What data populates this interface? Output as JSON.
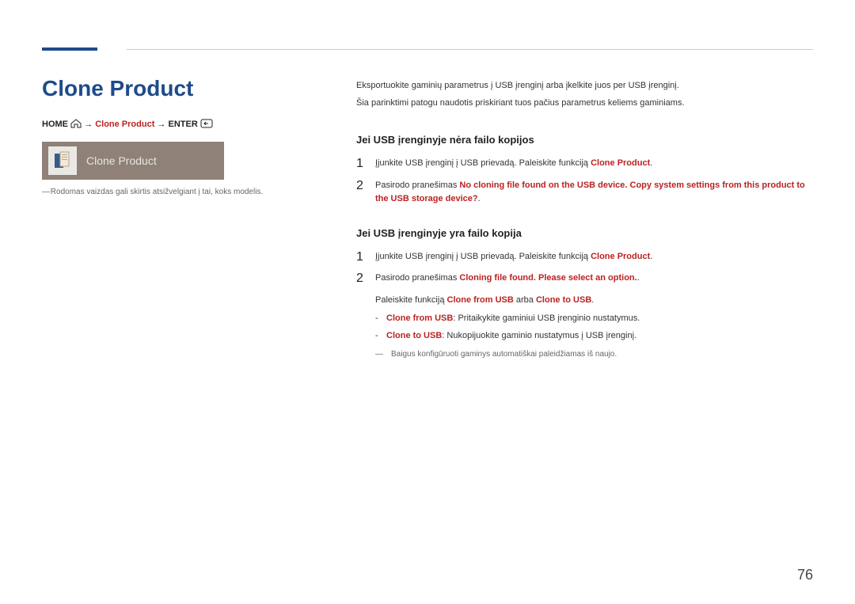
{
  "title": "Clone Product",
  "breadcrumb": {
    "home": "HOME",
    "arrow": "→",
    "mid": "Clone Product",
    "enter": "ENTER"
  },
  "panel": {
    "label": "Clone Product"
  },
  "footnote_left": "Rodomas vaizdas gali skirtis atsižvelgiant į tai, koks modelis.",
  "intro1": "Eksportuokite gaminių parametrus į USB įrenginį arba įkelkite juos per USB įrenginį.",
  "intro2": "Šia parinktimi patogu naudotis priskiriant tuos pačius parametrus keliems gaminiams.",
  "sec1": {
    "head": "Jei USB įrenginyje nėra failo kopijos",
    "s1_a": "Įjunkite USB įrenginį į USB prievadą. Paleiskite funkciją ",
    "s1_b": "Clone Product",
    "s1_c": ".",
    "s2_a": "Pasirodo pranešimas ",
    "s2_b": "No cloning file found on the USB device. Copy system settings from this product to the USB storage device?",
    "s2_c": "."
  },
  "sec2": {
    "head": "Jei USB įrenginyje yra failo kopija",
    "s1_a": "Įjunkite USB įrenginį į USB prievadą. Paleiskite funkciją ",
    "s1_b": "Clone Product",
    "s1_c": ".",
    "s2_a": "Pasirodo pranešimas ",
    "s2_b": "Cloning file found. Please select an option.",
    "s2_c": ".",
    "sub_a": "Paleiskite funkciją ",
    "sub_b": "Clone from USB",
    "sub_c": " arba ",
    "sub_d": "Clone to USB",
    "sub_e": ".",
    "d1_a": "Clone from USB",
    "d1_b": ": Pritaikykite gaminiui USB įrenginio nustatymus.",
    "d2_a": "Clone to USB",
    "d2_b": ": Nukopijuokite gaminio nustatymus į USB įrenginį.",
    "note": "Baigus konfigūruoti gaminys automatiškai paleidžiamas iš naujo."
  },
  "page_number": "76"
}
